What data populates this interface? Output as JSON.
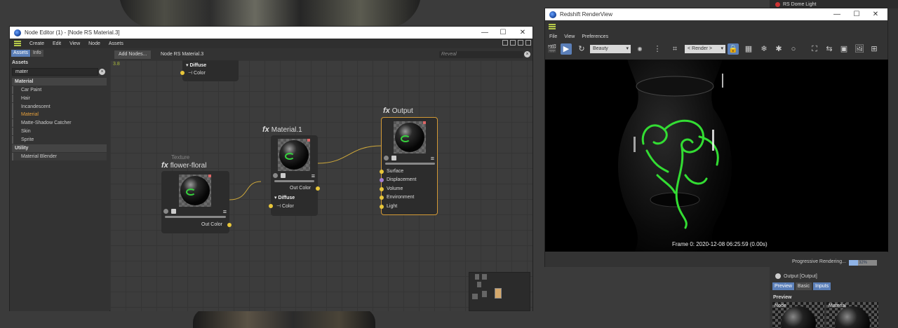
{
  "background_panel": {
    "dome_light_label": "RS Dome Light",
    "output_label": "Output [Output]",
    "tabs": [
      "Preview",
      "Basic",
      "Inputs"
    ],
    "active_tabs": [
      "Preview",
      "Inputs"
    ],
    "preview_heading": "Preview",
    "preview_node_label": "Node",
    "preview_material_label": "Material"
  },
  "node_editor": {
    "title": "Node Editor (1) - [Node RS Material.3]",
    "menu": [
      "Create",
      "Edit",
      "View",
      "Node",
      "Assets"
    ],
    "tabs": [
      "Assets",
      "Info"
    ],
    "assets_heading": "Assets",
    "search_value": "mater",
    "categories": [
      {
        "name": "Material",
        "items": [
          "Car Paint",
          "Hair",
          "Incandescent",
          "Material",
          "Matte-Shadow Catcher",
          "Skin",
          "Sprite"
        ]
      },
      {
        "name": "Utility",
        "items": [
          "Material Blender"
        ]
      }
    ],
    "highlighted_item": "Material",
    "add_nodes_label": "Add Nodes...",
    "breadcrumb": "Node RS Material.3",
    "reveal_placeholder": "Reveal",
    "version": "3.8",
    "nodes": {
      "top_partial": {
        "group": "Diffuse",
        "port": "Color"
      },
      "texture": {
        "subtitle": "Texture",
        "title": "flower-floral",
        "out_port": "Out Color"
      },
      "material": {
        "title": "Material.1",
        "out_port": "Out Color",
        "group": "Diffuse",
        "port": "Color"
      },
      "output": {
        "title": "Output",
        "ports": [
          "Surface",
          "Displacement",
          "Volume",
          "Environment",
          "Light"
        ]
      }
    }
  },
  "render_view": {
    "title": "Redshift RenderView",
    "menu": [
      "File",
      "View",
      "Preferences"
    ],
    "aov_select": "Beauty",
    "camera_select": "< Render >",
    "frame_info": "Frame 0:  2020-12-08  06:25:59  (0.00s)",
    "progress_label": "Progressive Rendering...",
    "progress_percent": 32,
    "progress_text": "32%"
  },
  "colors": {
    "accent_blue": "#5b7fb8",
    "port_yellow": "#e8c63a",
    "port_purple": "#a37fd1",
    "output_border": "#d49a36",
    "glow_green": "#33dd33"
  }
}
